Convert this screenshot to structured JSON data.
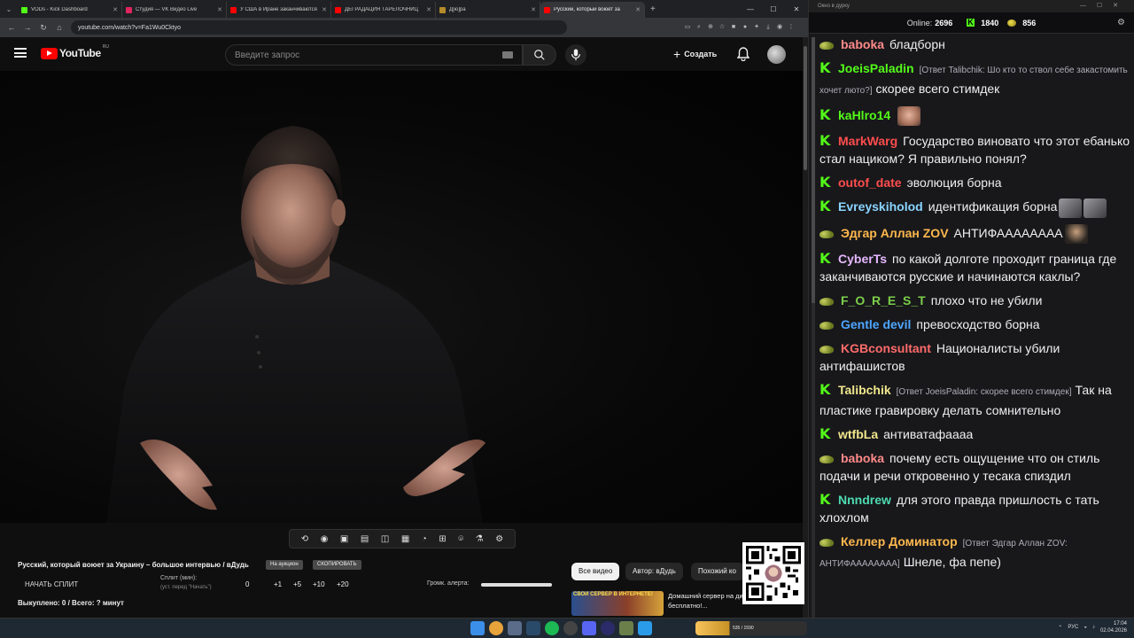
{
  "browser": {
    "tabs": [
      {
        "title": "VODs - Kick Dashboard",
        "color": "#53fc18"
      },
      {
        "title": "Студия — VK Видео Live",
        "color": "#e0245e"
      },
      {
        "title": "У США в Иране заканчиваются",
        "color": "#ff0000"
      },
      {
        "title": "ДЕГРАДАЦИЯ ТАРЕЛОЧНИЦ",
        "color": "#ff0000"
      },
      {
        "title": "Д[ю]ра",
        "color": "#b48a2a"
      },
      {
        "title": "Русский, который воюет за",
        "color": "#ff0000"
      }
    ],
    "url": "youtube.com/watch?v=Fa1Wu0Cktyo"
  },
  "youtube": {
    "logo_text": "YouTube",
    "region": "RU",
    "search_placeholder": "Введите запрос",
    "create_label": "Создать"
  },
  "video": {
    "title": "Русский, который воюет за Украину – большое интервью / вДудь",
    "chip_auction": "На аукцион",
    "chip_copy": "СКОПИРОВАТЬ",
    "start_split": "НАЧАТЬ СПЛИТ",
    "split_minutes_label": "Сплит (мин):",
    "split_minutes_sub": "(уст. перед \"Начать\")",
    "split_value": "0",
    "split_steps": [
      "+1",
      "+5",
      "+10",
      "+20"
    ],
    "alert_volume_label": "Громк. алерта:",
    "alert_volume_level": 1.0,
    "bought_status": "Выкуплено: 0 / Всего: ? минут"
  },
  "filters": [
    "Все видео",
    "Автор: вДудь",
    "Похожий ко"
  ],
  "ad": {
    "thumb_text": "СВОЙ СЕРВЕР В ИНТЕРНЕТЕ!",
    "text": "Домашний сервер на динамическом IP бесплатно!..."
  },
  "chat": {
    "window_title": "Окно в дурку",
    "online_label": "Online:",
    "online_count": "2696",
    "kick_count": "1840",
    "coin_count": "856",
    "messages": [
      {
        "badge": "pepe",
        "user": "baboka",
        "color": "#ff8a8a",
        "reply": "",
        "text": "бладборн",
        "emotes": []
      },
      {
        "badge": "kick",
        "user": "JoeisPaladin",
        "color": "#53fc18",
        "reply": "[Ответ Talibchik: Шо кто то ствол себе закастомить хочет люто?]",
        "text": "скорее всего стимдек",
        "emotes": []
      },
      {
        "badge": "kick",
        "user": "kaHlro14",
        "color": "#53fc18",
        "reply": "",
        "text": "",
        "emotes": [
          "face"
        ]
      },
      {
        "badge": "kick",
        "user": "MarkWarg",
        "color": "#ff4d4d",
        "reply": "",
        "text": "Государство виновато что этот ебанько стал нациком? Я правильно понял?",
        "emotes": []
      },
      {
        "badge": "kick",
        "user": "outof_date",
        "color": "#ff4d4d",
        "reply": "",
        "text": "эволюция борна",
        "emotes": []
      },
      {
        "badge": "kick",
        "user": "Evreyskiholod",
        "color": "#8ad4ff",
        "reply": "",
        "text": "идентификация борна",
        "emotes": [
          "gray",
          "gray"
        ]
      },
      {
        "badge": "pepe",
        "user": "Эдгар Аллан ZOV",
        "color": "#ffb84d",
        "reply": "",
        "text": "АНТИФАААААААА",
        "emotes": [
          "dark"
        ]
      },
      {
        "badge": "kick",
        "user": "CyberTs",
        "color": "#e6b8ff",
        "reply": "",
        "text": "по какой долготе проходит граница где заканчиваются русские и начинаются каклы?",
        "emotes": []
      },
      {
        "badge": "pepe",
        "user": "F_O_R_E_S_T",
        "color": "#7ccf4a",
        "reply": "",
        "text": "плохо что не убили",
        "emotes": []
      },
      {
        "badge": "pepe",
        "user": "Gentle devil",
        "color": "#4da6ff",
        "reply": "",
        "text": "превосходство борна",
        "emotes": []
      },
      {
        "badge": "pepe",
        "user": "KGBconsultant",
        "color": "#ff6b6b",
        "reply": "",
        "text": "Националисты убили антифашистов",
        "emotes": []
      },
      {
        "badge": "kick",
        "user": "Talibchik",
        "color": "#f0e68c",
        "reply": "[Ответ JoeisPaladin: скорее всего стимдек]",
        "text": "Так на пластике гравировку делать сомнительно",
        "emotes": []
      },
      {
        "badge": "kick",
        "user": "wtfbLa",
        "color": "#f0e68c",
        "reply": "",
        "text": "антиватафаааа",
        "emotes": []
      },
      {
        "badge": "pepe",
        "user": "baboka",
        "color": "#ff8a8a",
        "reply": "",
        "text": "почему есть ощущение что он стиль подачи и речи откровенно у тесака спиздил",
        "emotes": []
      },
      {
        "badge": "kick",
        "user": "Nnndrew",
        "color": "#4ddbb0",
        "reply": "",
        "text": "для этого правда пришлость с тать хлохлом",
        "emotes": []
      },
      {
        "badge": "pepe",
        "user": "Келлер Доминатор",
        "color": "#ffb84d",
        "reply": "[Ответ Эдгар Аллан ZOV: АНТИФАААААААА]",
        "text": "Шнеле, фа пепе)",
        "emotes": []
      }
    ]
  },
  "taskbar": {
    "app_label": "535 / 1590",
    "lang": "РУС",
    "time": "17:04",
    "date": "02.04.2026"
  }
}
